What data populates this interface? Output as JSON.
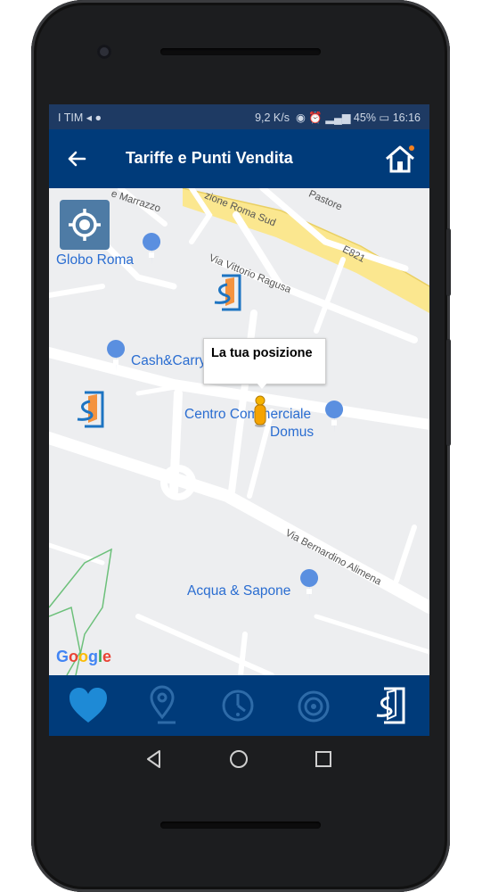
{
  "status_bar": {
    "carrier": "I TIM",
    "speed": "9,2 K/s",
    "battery": "45%",
    "time": "16:16"
  },
  "app_bar": {
    "title": "Tariffe e Punti Vendita",
    "back_icon": "arrow-left-icon",
    "home_icon": "home-icon"
  },
  "map": {
    "location_button_icon": "crosshair-gps-icon",
    "pois": [
      "Globo Roma",
      "Cash&Carry",
      "Centro Commerciale",
      "Domus",
      "Acqua & Sapone"
    ],
    "streets": [
      "e Marrazzo",
      "zione Roma Sud",
      "Pastore",
      "E821",
      "Via Vittorio Ragusa",
      "Via Bernardino Alimena"
    ],
    "position_popup": "La tua posizione",
    "attribution": [
      "G",
      "o",
      "o",
      "g",
      "l",
      "e"
    ]
  },
  "bottom_nav": [
    {
      "name": "favorites",
      "icon": "heart-icon"
    },
    {
      "name": "map-pin",
      "icon": "pin-icon"
    },
    {
      "name": "clock",
      "icon": "clock-icon"
    },
    {
      "name": "signal",
      "icon": "signal-icon"
    },
    {
      "name": "store",
      "icon": "store-door-icon"
    }
  ],
  "colors": {
    "app_bar": "#003b7a",
    "status_bar": "#1e3a63",
    "nav_inactive": "#2e6ba8",
    "nav_active": "#ffffff",
    "favorite": "#1e8ad6",
    "poi_text": "#2a6dd1"
  }
}
